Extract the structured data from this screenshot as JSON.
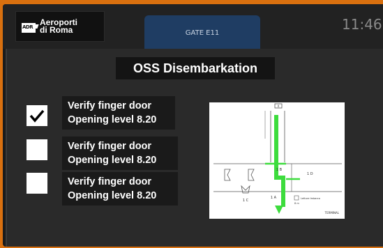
{
  "header": {
    "logo_line1": "Aeroporti",
    "logo_line2": "di Roma",
    "logo_mark": "ADR",
    "gate_tab": "GATE E11",
    "time": "11:46"
  },
  "main": {
    "title": "OSS Disembarkation",
    "items": [
      {
        "line1": "Verify finger door",
        "line2": "Opening level 8.20",
        "checked": true
      },
      {
        "line1": "Verify finger door",
        "line2": "Opening level 8.20",
        "checked": false
      },
      {
        "line1": "Verify finger door",
        "line2": "Opening level 8.20",
        "checked": false
      }
    ]
  },
  "diagram": {
    "labels": {
      "top_box": "X",
      "door_1b": "1 B",
      "door_1d": "1 D",
      "door_1c": "1 C",
      "door_1a": "1 A",
      "legend": "Letture Imbarco",
      "legend_sub": "8 m",
      "terminal": "TERMINAL"
    },
    "colors": {
      "route": "#3ddc3d",
      "lines": "#555555"
    }
  },
  "colors": {
    "frame_border": "#d9700f",
    "tab_active": "#1f3d63",
    "panel": "#2a2a2a"
  }
}
